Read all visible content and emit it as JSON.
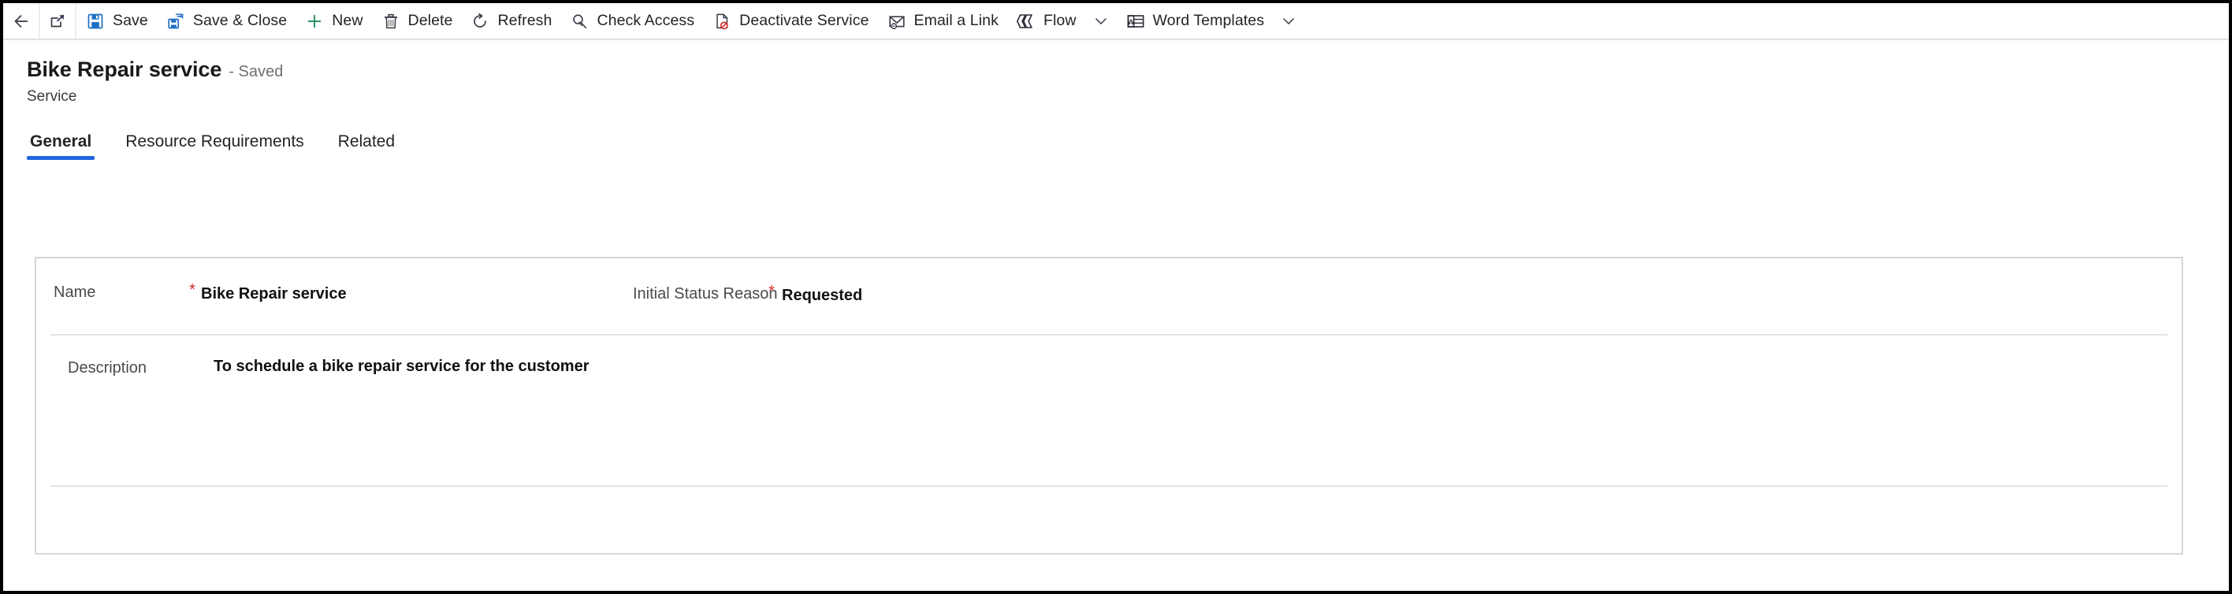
{
  "command_bar": {
    "nav": [
      {
        "name": "back-button",
        "icon": "back-arrow-icon"
      },
      {
        "name": "popout-button",
        "icon": "popout-icon"
      }
    ],
    "commands": [
      {
        "label": "Save",
        "icon": "save-icon",
        "chevron": false
      },
      {
        "label": "Save & Close",
        "icon": "save-and-close-icon",
        "chevron": false
      },
      {
        "label": "New",
        "icon": "plus-icon",
        "chevron": false
      },
      {
        "label": "Delete",
        "icon": "trash-icon",
        "chevron": false
      },
      {
        "label": "Refresh",
        "icon": "refresh-icon",
        "chevron": false
      },
      {
        "label": "Check Access",
        "icon": "key-icon",
        "chevron": false
      },
      {
        "label": "Deactivate Service",
        "icon": "deactivate-icon",
        "chevron": false
      },
      {
        "label": "Email a Link",
        "icon": "email-link-icon",
        "chevron": false
      },
      {
        "label": "Flow",
        "icon": "flow-icon",
        "chevron": true
      },
      {
        "label": "Word Templates",
        "icon": "word-template-icon",
        "chevron": true
      }
    ]
  },
  "header": {
    "title": "Bike Repair service",
    "saved_state": "- Saved",
    "entity_name": "Service"
  },
  "tabs": [
    {
      "label": "General",
      "active": true
    },
    {
      "label": "Resource Requirements",
      "active": false
    },
    {
      "label": "Related",
      "active": false
    }
  ],
  "form": {
    "required_marker": "*",
    "fields": {
      "name": {
        "label": "Name",
        "value": "Bike Repair service",
        "required": true
      },
      "initial_status_reason": {
        "label": "Initial Status Reason",
        "value": "Requested",
        "required": true
      },
      "description": {
        "label": "Description",
        "value": "To schedule a bike repair service for the customer",
        "required": false
      }
    }
  },
  "colors": {
    "accent": "#2266dd",
    "required": "#d42b2b",
    "new_icon": "#1a8754",
    "save_icon": "#1f6fc4",
    "card_border": "#d6d6d6"
  }
}
